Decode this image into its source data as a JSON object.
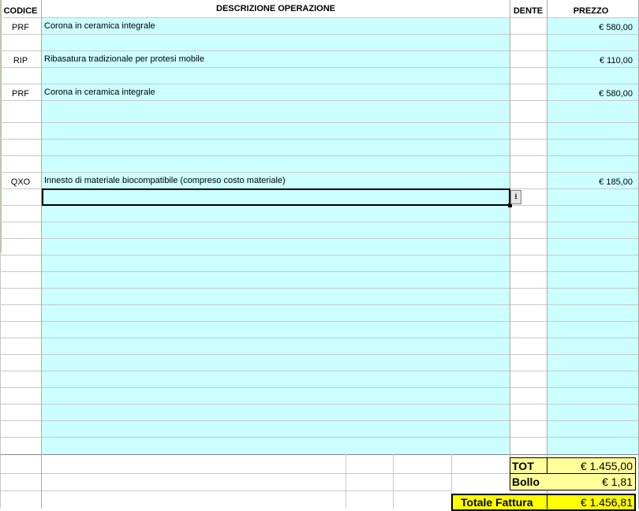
{
  "headers": {
    "codice": "CODICE",
    "descrizione": "DESCRIZIONE OPERAZIONE",
    "dente": "DENTE",
    "prezzo": "PREZZO"
  },
  "rows": [
    {
      "codice": "PRF",
      "descrizione": "Corona in ceramica integrale",
      "prezzo": "€ 580,00"
    },
    {
      "codice": "RIP",
      "descrizione": "Ribasatura tradizionale per protesi mobile",
      "prezzo": "€ 110,00"
    },
    {
      "codice": "PRF",
      "descrizione": "Corona in ceramica integrale",
      "prezzo": "€ 580,00"
    },
    {
      "codice": "QXO",
      "descrizione": "Innesto di materiale biocompatibile (compreso costo materiale)",
      "prezzo": "€ 185,00"
    }
  ],
  "dropdown_icon": "arrow-down-icon",
  "totals": {
    "tot_label": "TOT",
    "tot_value": "€ 1.455,00",
    "bollo_label": "Bollo",
    "bollo_value": "€ 1,81",
    "totale_label": "Totale Fattura",
    "totale_value": "€ 1.456,81"
  },
  "colors": {
    "cell_fill": "#ccffff",
    "total_fill": "#ffff99",
    "grand_total_fill": "#ffff00"
  }
}
